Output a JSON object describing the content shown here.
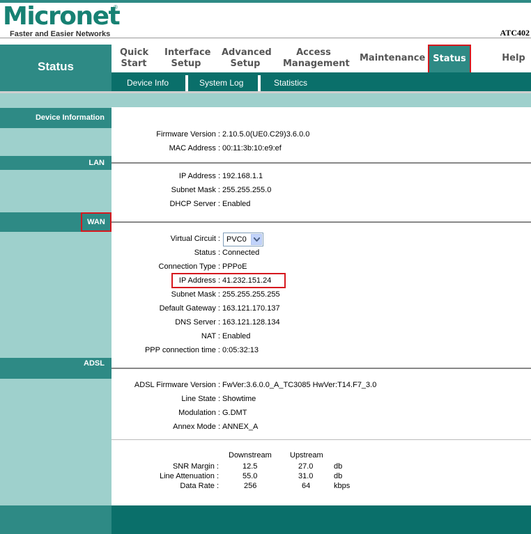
{
  "brand": {
    "logo": "Micronet",
    "registered": "®",
    "tagline": "Faster and Easier Networks",
    "model": "ATC402"
  },
  "nav": {
    "section_title": "Status",
    "menu": [
      {
        "label_line1": "Quick",
        "label_line2": "Start"
      },
      {
        "label_line1": "Interface",
        "label_line2": "Setup"
      },
      {
        "label_line1": "Advanced",
        "label_line2": "Setup"
      },
      {
        "label_line1": "Access",
        "label_line2": "Management"
      },
      {
        "label_line1": "Maintenance",
        "label_line2": ""
      },
      {
        "label_line1": "Status",
        "label_line2": ""
      },
      {
        "label_line1": "Help",
        "label_line2": ""
      }
    ],
    "submenu": [
      "Device Info",
      "System Log",
      "Statistics"
    ]
  },
  "device_info": {
    "heading": "Device Information",
    "firmware_label": "Firmware Version :",
    "firmware": "2.10.5.0(UE0.C29)3.6.0.0",
    "mac_label": "MAC Address :",
    "mac": "00:11:3b:10:e9:ef"
  },
  "lan": {
    "heading": "LAN",
    "ip_label": "IP Address :",
    "ip": "192.168.1.1",
    "mask_label": "Subnet Mask :",
    "mask": "255.255.255.0",
    "dhcp_label": "DHCP Server :",
    "dhcp": "Enabled"
  },
  "wan": {
    "heading": "WAN",
    "vc_label": "Virtual Circuit :",
    "vc": "PVC0",
    "status_label": "Status :",
    "status": "Connected",
    "conn_label": "Connection Type :",
    "conn": "PPPoE",
    "ip_label": "IP Address :",
    "ip": "41.232.151.24",
    "mask_label": "Subnet Mask :",
    "mask": "255.255.255.255",
    "gw_label": "Default Gateway :",
    "gw": "163.121.170.137",
    "dns_label": "DNS Server :",
    "dns": "163.121.128.134",
    "nat_label": "NAT :",
    "nat": "Enabled",
    "ppp_label": "PPP connection time :",
    "ppp": "0:05:32:13"
  },
  "adsl": {
    "heading": "ADSL",
    "fw_label": "ADSL Firmware Version :",
    "fw": "FwVer:3.6.0.0_A_TC3085 HwVer:T14.F7_3.0",
    "line_label": "Line State :",
    "line": "Showtime",
    "mod_label": "Modulation :",
    "mod": "G.DMT",
    "annex_label": "Annex Mode :",
    "annex": "ANNEX_A",
    "stats": {
      "downstream": "Downstream",
      "upstream": "Upstream",
      "rows": [
        {
          "label": "SNR Margin :",
          "down": "12.5",
          "up": "27.0",
          "unit": "db"
        },
        {
          "label": "Line Attenuation :",
          "down": "55.0",
          "up": "31.0",
          "unit": "db"
        },
        {
          "label": "Data Rate :",
          "down": "256",
          "up": "64",
          "unit": "kbps"
        }
      ]
    }
  }
}
